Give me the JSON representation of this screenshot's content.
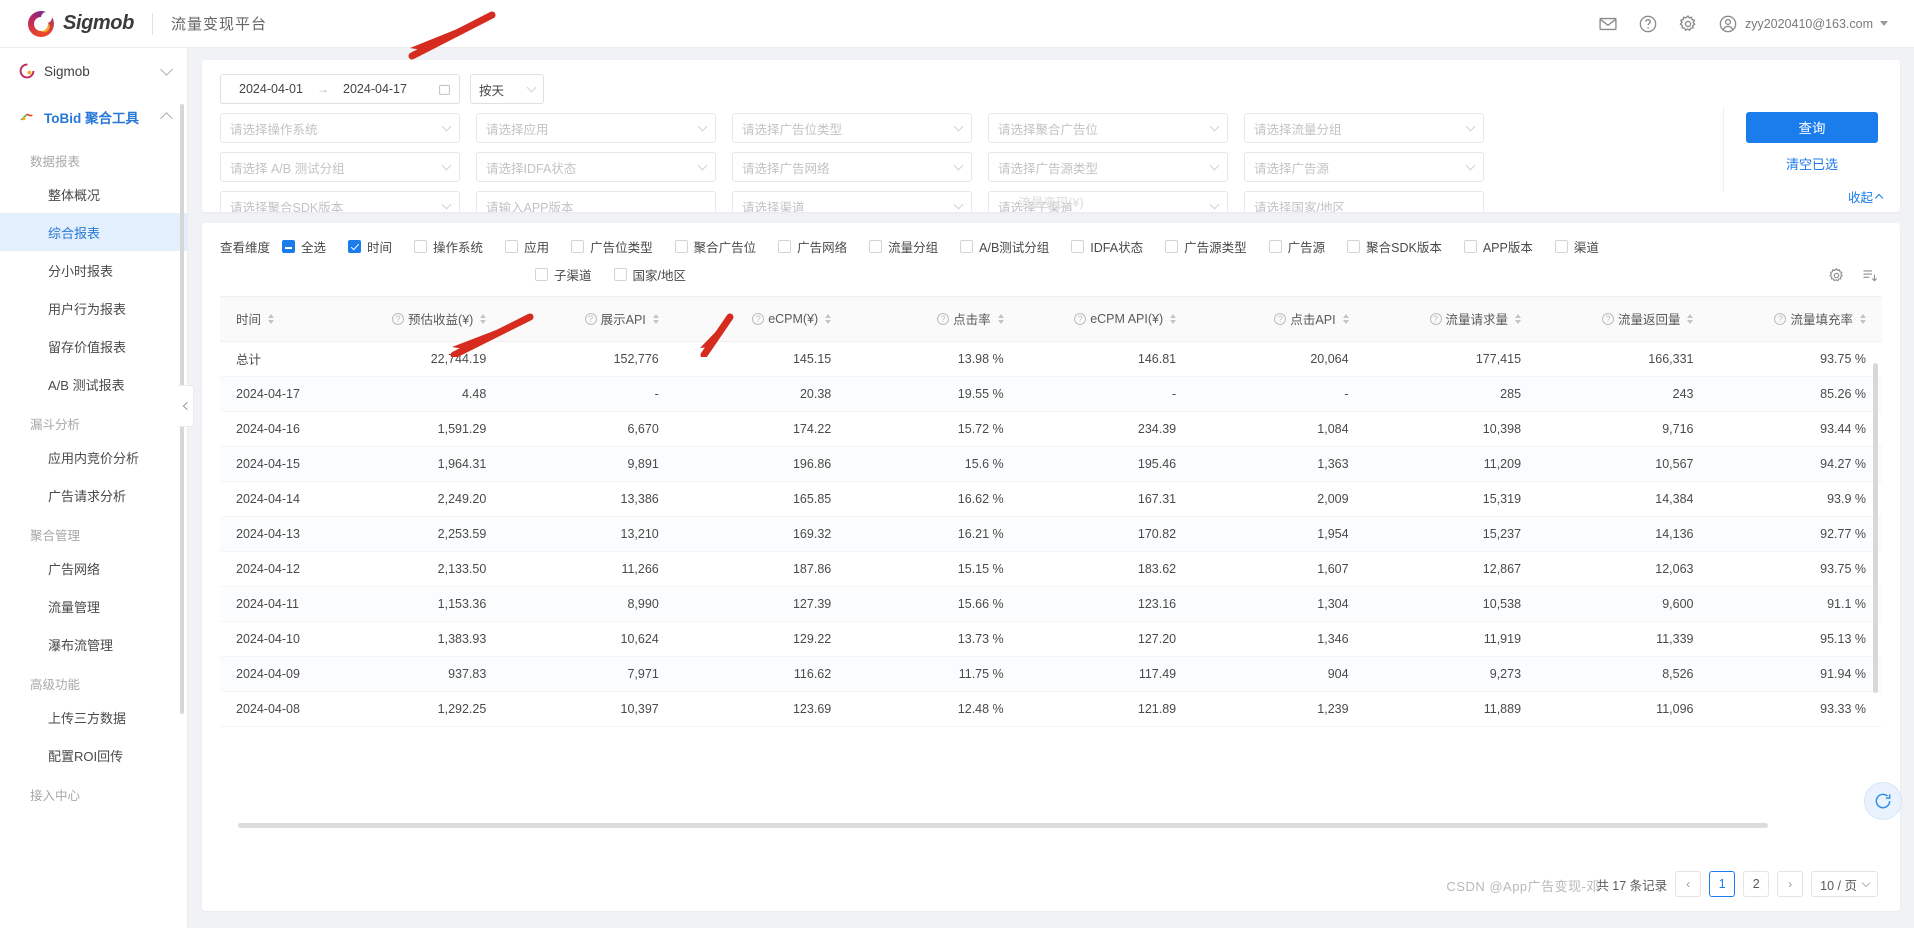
{
  "topbar": {
    "logo_text": "Sigmob",
    "subtitle": "流量变现平台",
    "icons": [
      "mail-icon",
      "help-icon",
      "gear-icon"
    ],
    "user_email": "zyy2020410@163.com"
  },
  "sidebar": {
    "groups": [
      {
        "label": "Sigmob",
        "icon": "sigmob-logo-icon",
        "expanded": false
      },
      {
        "label": "ToBid 聚合工具",
        "icon": "tobid-icon",
        "expanded": true
      }
    ],
    "sections": [
      {
        "title": "数据报表",
        "items": [
          {
            "label": "整体概况",
            "active": false
          },
          {
            "label": "综合报表",
            "active": true
          },
          {
            "label": "分小时报表",
            "active": false
          },
          {
            "label": "用户行为报表",
            "active": false
          },
          {
            "label": "留存价值报表",
            "active": false
          },
          {
            "label": "A/B 测试报表",
            "active": false
          }
        ]
      },
      {
        "title": "漏斗分析",
        "items": [
          {
            "label": "应用内竞价分析",
            "active": false
          },
          {
            "label": "广告请求分析",
            "active": false
          }
        ]
      },
      {
        "title": "聚合管理",
        "items": [
          {
            "label": "广告网络",
            "active": false
          },
          {
            "label": "流量管理",
            "active": false
          },
          {
            "label": "瀑布流管理",
            "active": false
          }
        ]
      },
      {
        "title": "高级功能",
        "items": [
          {
            "label": "上传三方数据",
            "active": false
          },
          {
            "label": "配置ROI回传",
            "active": false
          }
        ]
      },
      {
        "title": "接入中心",
        "items": []
      }
    ]
  },
  "filters": {
    "date_start": "2024-04-01",
    "date_end": "2024-04-17",
    "date_arrow": "→",
    "granularity": "按天",
    "row1": [
      "请选择操作系统",
      "请选择应用",
      "请选择广告位类型",
      "请选择聚合广告位",
      "请选择流量分组"
    ],
    "row2": [
      "请选择 A/B 测试分组",
      "请选择IDFA状态",
      "请选择广告网络",
      "请选择广告源类型",
      "请选择广告源"
    ],
    "row3": [
      "请选择聚合SDK版本",
      "请输入APP版本",
      "请选择渠道",
      "请选择子渠道",
      "请选择国家/地区"
    ],
    "query_label": "查询",
    "clear_label": "清空已选",
    "collapse_label": "收起",
    "ghost_text": "流量变现(¥)"
  },
  "dimensions": {
    "label": "查看维度",
    "select_all": {
      "label": "全选",
      "state": "indeterminate"
    },
    "items_row1": [
      {
        "label": "时间",
        "checked": true
      },
      {
        "label": "操作系统",
        "checked": false
      },
      {
        "label": "应用",
        "checked": false
      },
      {
        "label": "广告位类型",
        "checked": false
      },
      {
        "label": "聚合广告位",
        "checked": false
      },
      {
        "label": "广告网络",
        "checked": false
      },
      {
        "label": "流量分组",
        "checked": false
      },
      {
        "label": "A/B测试分组",
        "checked": false
      },
      {
        "label": "IDFA状态",
        "checked": false
      },
      {
        "label": "广告源类型",
        "checked": false
      },
      {
        "label": "广告源",
        "checked": false
      },
      {
        "label": "聚合SDK版本",
        "checked": false
      },
      {
        "label": "APP版本",
        "checked": false
      },
      {
        "label": "渠道",
        "checked": false
      }
    ],
    "items_row2": [
      {
        "label": "子渠道",
        "checked": false
      },
      {
        "label": "国家/地区",
        "checked": false
      }
    ],
    "tools": [
      "gear-icon",
      "export-icon"
    ]
  },
  "table": {
    "columns": [
      {
        "key": "time",
        "label": "时间",
        "has_help": false,
        "sortable": true
      },
      {
        "key": "revenue",
        "label": "预估收益(¥)",
        "has_help": true,
        "sortable": true
      },
      {
        "key": "impr_api",
        "label": "展示API",
        "has_help": true,
        "sortable": true
      },
      {
        "key": "ecpm",
        "label": "eCPM(¥)",
        "has_help": true,
        "sortable": true
      },
      {
        "key": "ctr",
        "label": "点击率",
        "has_help": true,
        "sortable": true
      },
      {
        "key": "ecpm_api",
        "label": "eCPM API(¥)",
        "has_help": true,
        "sortable": true
      },
      {
        "key": "click_api",
        "label": "点击API",
        "has_help": true,
        "sortable": true
      },
      {
        "key": "req",
        "label": "流量请求量",
        "has_help": true,
        "sortable": true
      },
      {
        "key": "ret",
        "label": "流量返回量",
        "has_help": true,
        "sortable": true
      },
      {
        "key": "fill",
        "label": "流量填充率",
        "has_help": true,
        "sortable": true
      }
    ],
    "total_row": {
      "time": "总计",
      "revenue": "22,744.19",
      "impr_api": "152,776",
      "ecpm": "145.15",
      "ctr": "13.98 %",
      "ecpm_api": "146.81",
      "click_api": "20,064",
      "req": "177,415",
      "ret": "166,331",
      "fill": "93.75 %"
    },
    "rows": [
      {
        "time": "2024-04-17",
        "revenue": "4.48",
        "impr_api": "-",
        "ecpm": "20.38",
        "ctr": "19.55 %",
        "ecpm_api": "-",
        "click_api": "-",
        "req": "285",
        "ret": "243",
        "fill": "85.26 %"
      },
      {
        "time": "2024-04-16",
        "revenue": "1,591.29",
        "impr_api": "6,670",
        "ecpm": "174.22",
        "ctr": "15.72 %",
        "ecpm_api": "234.39",
        "click_api": "1,084",
        "req": "10,398",
        "ret": "9,716",
        "fill": "93.44 %"
      },
      {
        "time": "2024-04-15",
        "revenue": "1,964.31",
        "impr_api": "9,891",
        "ecpm": "196.86",
        "ctr": "15.6 %",
        "ecpm_api": "195.46",
        "click_api": "1,363",
        "req": "11,209",
        "ret": "10,567",
        "fill": "94.27 %"
      },
      {
        "time": "2024-04-14",
        "revenue": "2,249.20",
        "impr_api": "13,386",
        "ecpm": "165.85",
        "ctr": "16.62 %",
        "ecpm_api": "167.31",
        "click_api": "2,009",
        "req": "15,319",
        "ret": "14,384",
        "fill": "93.9 %"
      },
      {
        "time": "2024-04-13",
        "revenue": "2,253.59",
        "impr_api": "13,210",
        "ecpm": "169.32",
        "ctr": "16.21 %",
        "ecpm_api": "170.82",
        "click_api": "1,954",
        "req": "15,237",
        "ret": "14,136",
        "fill": "92.77 %"
      },
      {
        "time": "2024-04-12",
        "revenue": "2,133.50",
        "impr_api": "11,266",
        "ecpm": "187.86",
        "ctr": "15.15 %",
        "ecpm_api": "183.62",
        "click_api": "1,607",
        "req": "12,867",
        "ret": "12,063",
        "fill": "93.75 %"
      },
      {
        "time": "2024-04-11",
        "revenue": "1,153.36",
        "impr_api": "8,990",
        "ecpm": "127.39",
        "ctr": "15.66 %",
        "ecpm_api": "123.16",
        "click_api": "1,304",
        "req": "10,538",
        "ret": "9,600",
        "fill": "91.1 %"
      },
      {
        "time": "2024-04-10",
        "revenue": "1,383.93",
        "impr_api": "10,624",
        "ecpm": "129.22",
        "ctr": "13.73 %",
        "ecpm_api": "127.20",
        "click_api": "1,346",
        "req": "11,919",
        "ret": "11,339",
        "fill": "95.13 %"
      },
      {
        "time": "2024-04-09",
        "revenue": "937.83",
        "impr_api": "7,971",
        "ecpm": "116.62",
        "ctr": "11.75 %",
        "ecpm_api": "117.49",
        "click_api": "904",
        "req": "9,273",
        "ret": "8,526",
        "fill": "91.94 %"
      },
      {
        "time": "2024-04-08",
        "revenue": "1,292.25",
        "impr_api": "10,397",
        "ecpm": "123.69",
        "ctr": "12.48 %",
        "ecpm_api": "121.89",
        "click_api": "1,239",
        "req": "11,889",
        "ret": "11,096",
        "fill": "93.33 %"
      }
    ]
  },
  "pagination": {
    "total_text": "共 17 条记录",
    "prev": "‹",
    "next": "›",
    "pages": [
      "1",
      "2"
    ],
    "current": "1",
    "page_size": "10 / 页"
  },
  "watermark": "CSDN @App广告变现-邓",
  "colors": {
    "primary": "#1b7ceb",
    "active_bg": "#e3effc",
    "annotation": "#d62b1f"
  }
}
